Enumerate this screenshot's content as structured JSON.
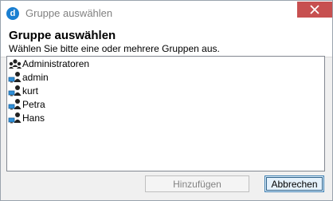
{
  "window": {
    "title": "Gruppe auswählen",
    "app_icon_letter": "d"
  },
  "header": {
    "heading": "Gruppe auswählen",
    "subheading": "Wählen Sie bitte eine oder mehrere Gruppen aus."
  },
  "list": {
    "items": [
      {
        "label": "Administratoren",
        "icon": "group-icon"
      },
      {
        "label": "admin",
        "icon": "user-computer-icon"
      },
      {
        "label": "kurt",
        "icon": "user-computer-icon"
      },
      {
        "label": "Petra",
        "icon": "user-computer-icon"
      },
      {
        "label": "Hans",
        "icon": "user-computer-icon"
      }
    ]
  },
  "buttons": {
    "add": "Hinzufügen",
    "cancel": "Abbrechen"
  },
  "colors": {
    "close_button": "#c75050",
    "app_icon": "#1a7fd1",
    "user_icon_screen": "#2e8fd8"
  }
}
